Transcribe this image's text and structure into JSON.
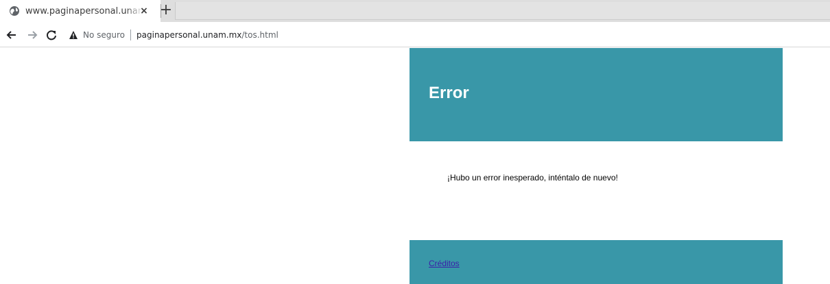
{
  "browser": {
    "tab": {
      "title": "www.paginapersonal.unam.mx/tos.html",
      "close_label": "×",
      "globe_icon": "globe-icon"
    },
    "new_tab_label": "+",
    "nav": {
      "back_icon": "arrow-left-icon",
      "forward_icon": "arrow-right-icon",
      "reload_icon": "reload-icon"
    },
    "omnibox": {
      "security_icon": "warning-triangle-icon",
      "security_label": "No seguro",
      "url_host": "paginapersonal.unam.mx",
      "url_path": "/tos.html"
    }
  },
  "page": {
    "header_title": "Error",
    "message": "¡Hubo un error inesperado, inténtalo de nuevo!",
    "footer_link": "Créditos",
    "accent_color": "#3997a8",
    "link_color": "#3a1ea8"
  }
}
